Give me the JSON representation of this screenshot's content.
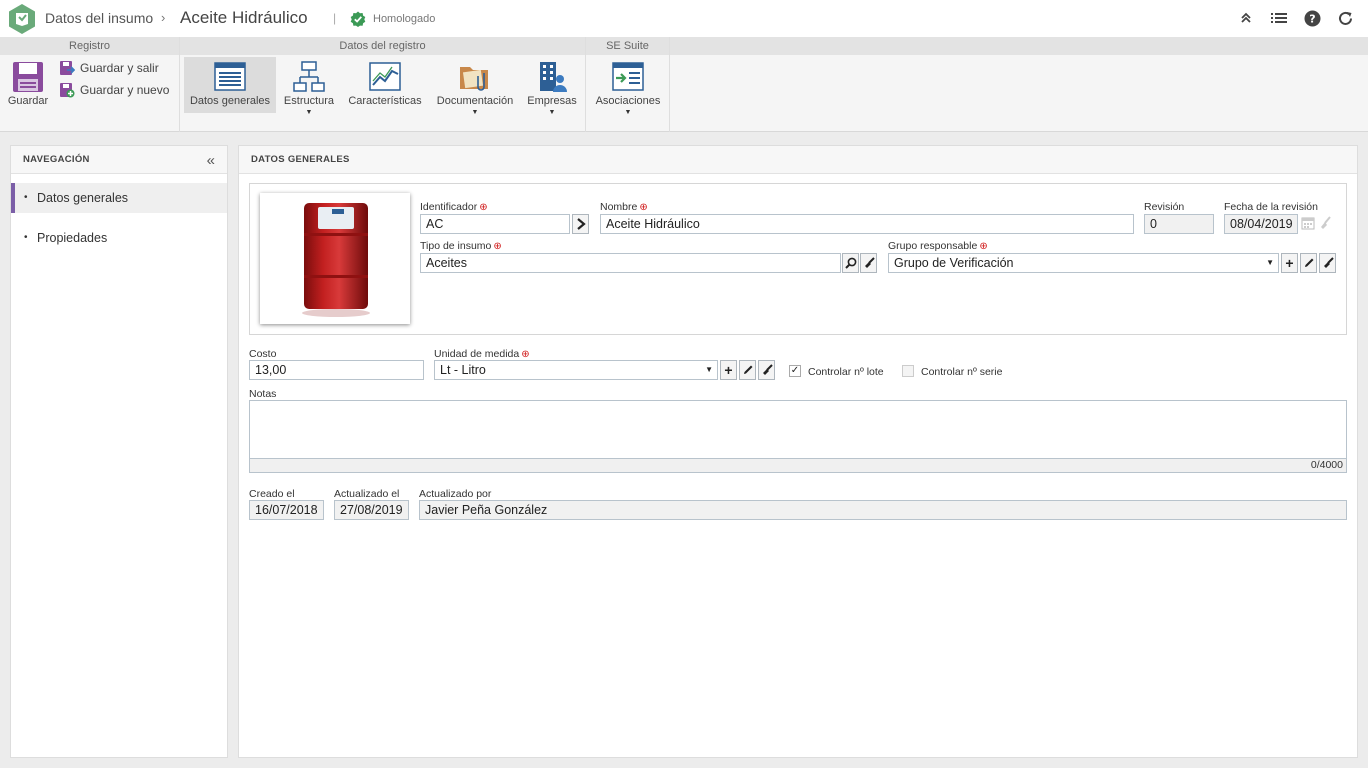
{
  "header": {
    "breadcrumb": "Datos del insumo",
    "breadcrumb_sep": "›",
    "title": "Aceite Hidráulico",
    "divider": "|",
    "status": "Homologado",
    "actions": [
      "collapse-up-icon",
      "list-icon",
      "help-icon",
      "refresh-icon"
    ]
  },
  "ribbon": {
    "groups": {
      "registro": "Registro",
      "datos_registro": "Datos del registro",
      "se_suite": "SE Suite"
    },
    "buttons": {
      "guardar": "Guardar",
      "guardar_salir": "Guardar y salir",
      "guardar_nuevo": "Guardar y nuevo",
      "datos_generales": "Datos generales",
      "estructura": "Estructura",
      "caracteristicas": "Características",
      "documentacion": "Documentación",
      "empresas": "Empresas",
      "asociaciones": "Asociaciones"
    },
    "caret": "▼"
  },
  "nav": {
    "title": "NAVEGACIÓN",
    "collapse": "«",
    "items": [
      {
        "label": "Datos generales",
        "active": true
      },
      {
        "label": "Propiedades",
        "active": false
      }
    ]
  },
  "main": {
    "title": "DATOS GENERALES",
    "req_mark": "⊕",
    "identificador": {
      "label": "Identificador",
      "value": "AC"
    },
    "nombre": {
      "label": "Nombre",
      "value": "Aceite Hidráulico"
    },
    "revision": {
      "label": "Revisión",
      "value": "0"
    },
    "fecha_revision": {
      "label": "Fecha de la revisión",
      "value": "08/04/2019"
    },
    "tipo_insumo": {
      "label": "Tipo de insumo",
      "value": "Aceites"
    },
    "grupo_responsable": {
      "label": "Grupo responsable",
      "value": "Grupo de Verificación"
    },
    "costo": {
      "label": "Costo",
      "value": "13,00"
    },
    "unidad_medida": {
      "label": "Unidad de medida",
      "value": "Lt - Litro"
    },
    "controlar_lote": {
      "label": "Controlar nº lote",
      "checked": true
    },
    "controlar_serie": {
      "label": "Controlar nº serie",
      "checked": false
    },
    "notas": {
      "label": "Notas",
      "counter": "0/4000"
    },
    "creado_el": {
      "label": "Creado el",
      "value": "16/07/2018"
    },
    "actualizado_el": {
      "label": "Actualizado el",
      "value": "27/08/2019"
    },
    "actualizado_por": {
      "label": "Actualizado por",
      "value": "Javier Peña González"
    }
  },
  "colors": {
    "accent": "#7b5ea7",
    "logo": "#6aaa7a",
    "status_ok": "#3c9a56",
    "required": "#d01b1b"
  }
}
